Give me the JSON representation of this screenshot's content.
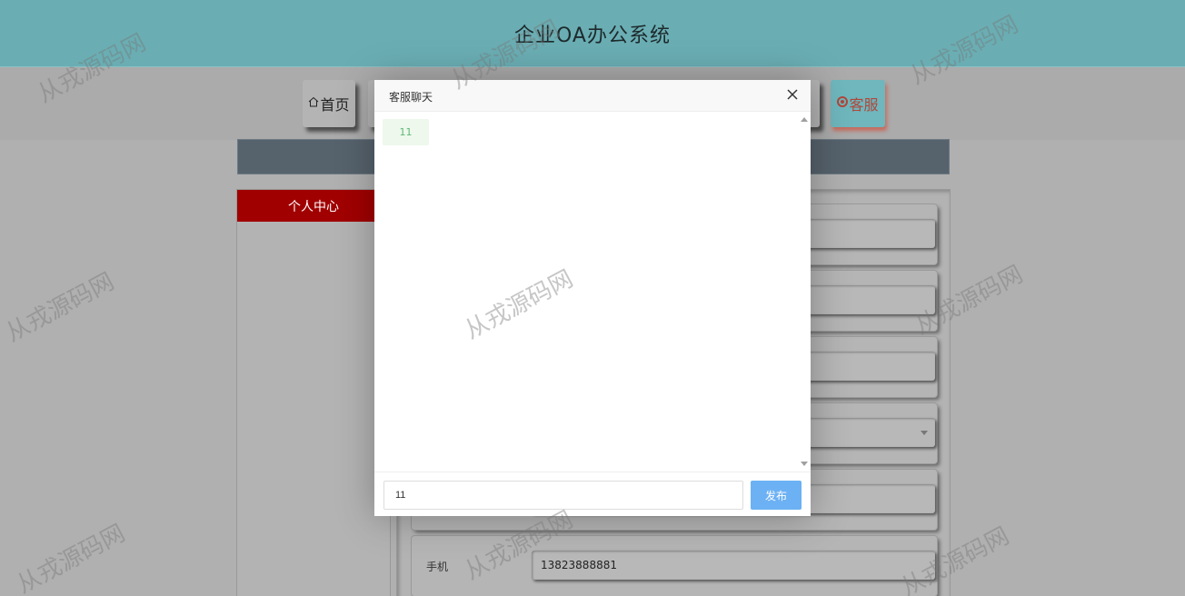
{
  "header": {
    "title": "企业OA办公系统"
  },
  "nav": {
    "home_label": "首页",
    "home_icon": "home-icon",
    "service_label": "客服",
    "service_icon": "circle-record-icon"
  },
  "left_panel": {
    "title": "个人中心"
  },
  "form": {
    "phone_label": "手机",
    "phone_value": "13823888881"
  },
  "modal": {
    "title": "客服聊天",
    "messages": [
      "11"
    ],
    "input_value": "11",
    "publish_label": "发布"
  },
  "watermark": {
    "text": "从戎源码网"
  },
  "colors": {
    "header_bg": "#6aaeb4",
    "panel_head": "#a10000",
    "publish_button": "#6cb1f4",
    "message_text": "#5fb878"
  }
}
